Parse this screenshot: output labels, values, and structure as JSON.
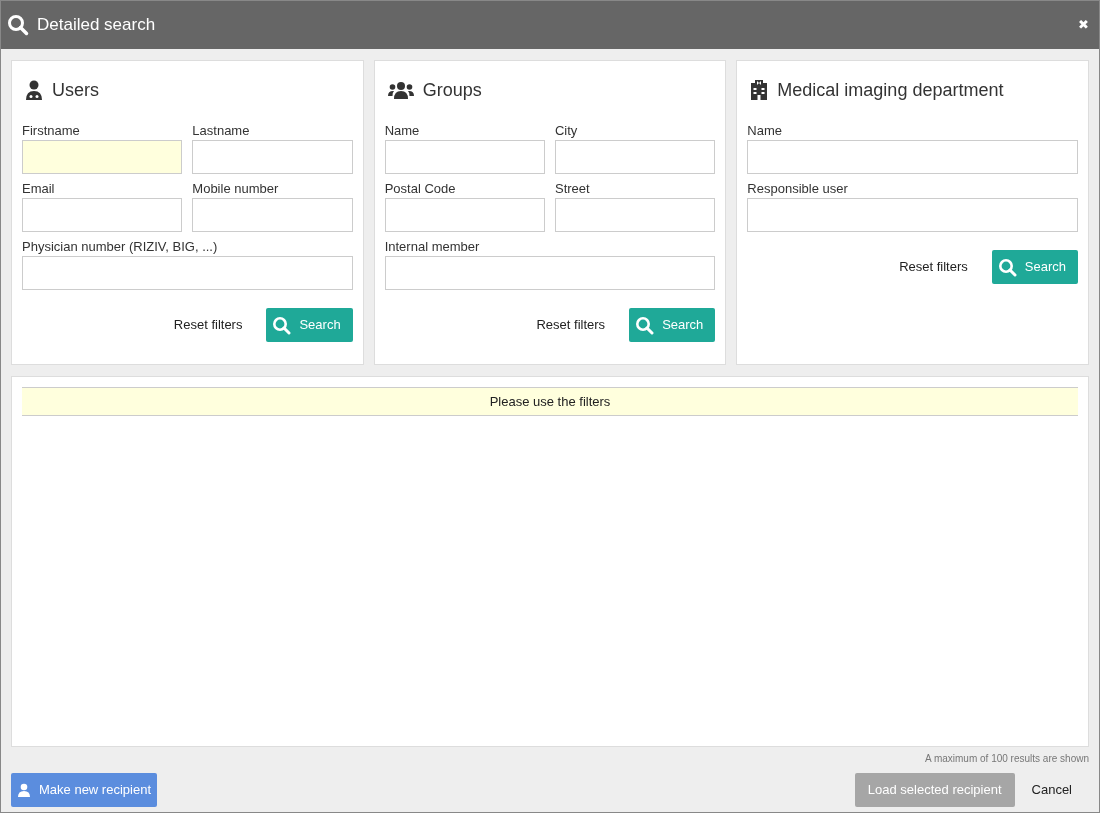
{
  "window": {
    "title": "Detailed search",
    "close": "✖"
  },
  "panels": [
    {
      "kind": "users",
      "title": "Users",
      "fields": [
        {
          "label": "Firstname",
          "wide": false,
          "focused": true
        },
        {
          "label": "Lastname",
          "wide": false,
          "focused": false
        },
        {
          "label": "Email",
          "wide": false,
          "focused": false
        },
        {
          "label": "Mobile number",
          "wide": false,
          "focused": false
        },
        {
          "label": "Physician number (RIZIV, BIG, ...)",
          "wide": true,
          "focused": false
        }
      ],
      "reset": "Reset filters",
      "search": "Search"
    },
    {
      "kind": "groups",
      "title": "Groups",
      "fields": [
        {
          "label": "Name",
          "wide": false,
          "focused": false
        },
        {
          "label": "City",
          "wide": false,
          "focused": false
        },
        {
          "label": "Postal Code",
          "wide": false,
          "focused": false
        },
        {
          "label": "Street",
          "wide": false,
          "focused": false
        },
        {
          "label": "Internal member",
          "wide": true,
          "focused": false
        }
      ],
      "reset": "Reset filters",
      "search": "Search"
    },
    {
      "kind": "department",
      "title": "Medical imaging department",
      "fields": [
        {
          "label": "Name",
          "wide": true,
          "focused": false
        },
        {
          "label": "Responsible user",
          "wide": true,
          "focused": false
        }
      ],
      "reset": "Reset filters",
      "search": "Search"
    }
  ],
  "results": {
    "message": "Please use the filters",
    "note": "A maximum of 100 results are shown"
  },
  "footer": {
    "new_button": "Make new recipient",
    "load_button": {
      "label": "Load selected recipient",
      "disabled": true
    },
    "cancel": "Cancel"
  }
}
